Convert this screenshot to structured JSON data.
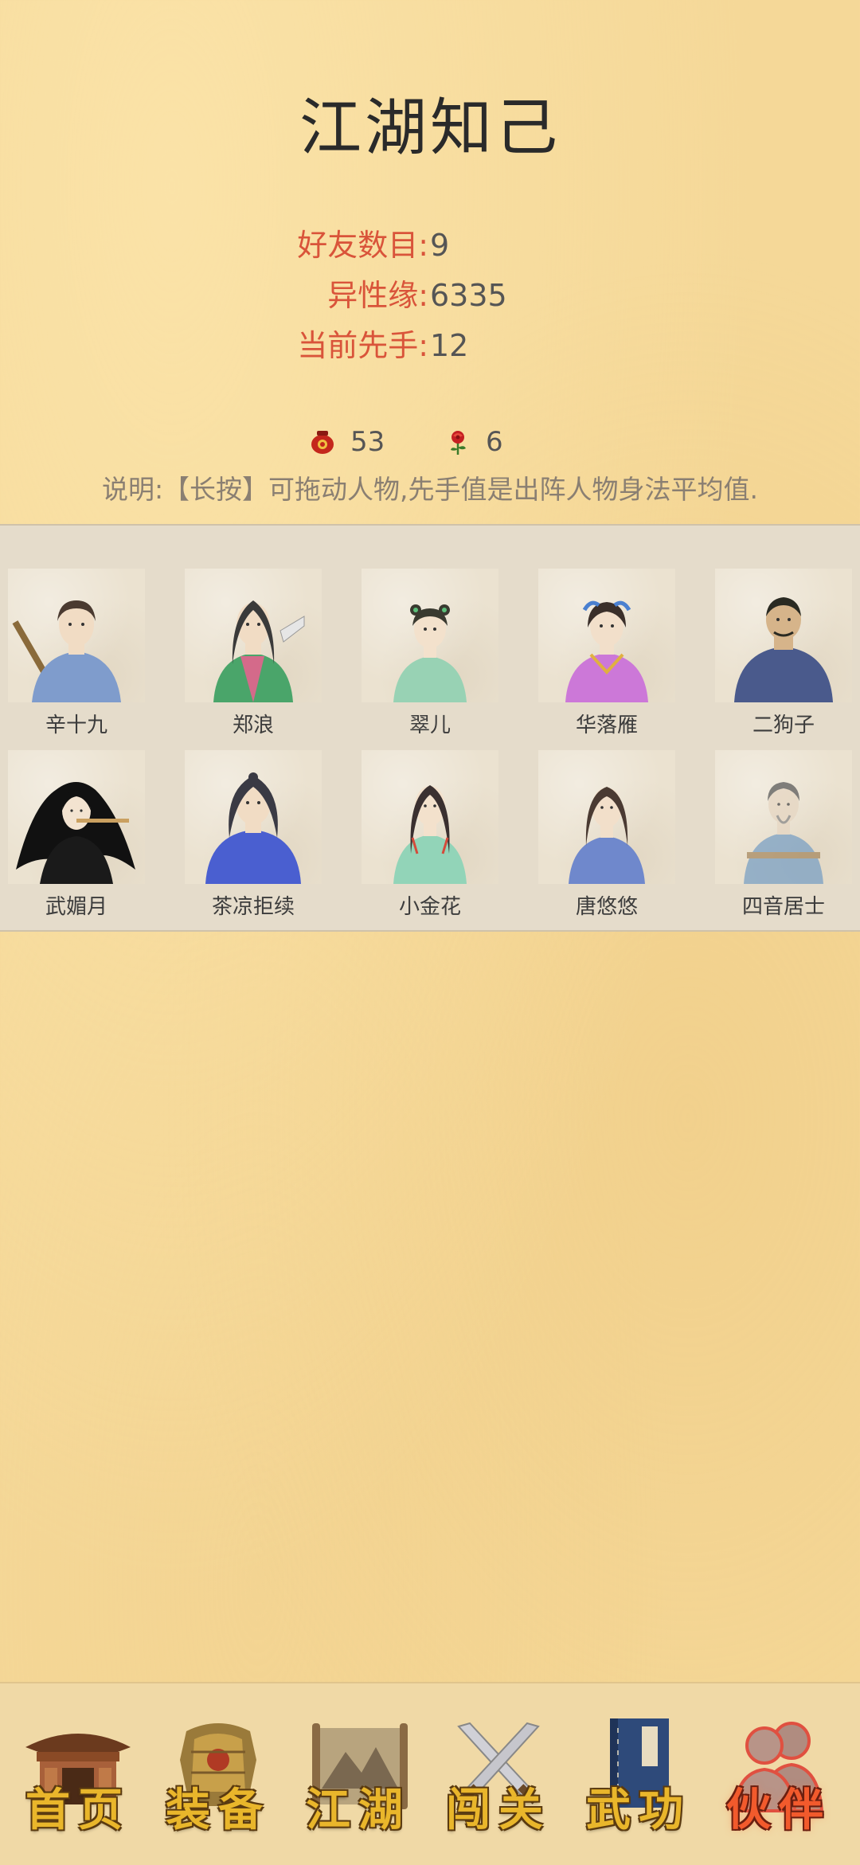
{
  "page": {
    "title": "江湖知己"
  },
  "stats": [
    {
      "label": "好友数目:",
      "value": "9"
    },
    {
      "label": "异性缘:",
      "value": "6335"
    },
    {
      "label": "当前先手:",
      "value": "12"
    }
  ],
  "resources": {
    "wine_count": "53",
    "rose_count": "6"
  },
  "note": "说明:【长按】可拖动人物,先手值是出阵人物身法平均值.",
  "characters": [
    {
      "name": "辛十九",
      "robe": "#7f9ccc",
      "hair": "#4a3a30"
    },
    {
      "name": "郑浪",
      "robe": "#4aa56a",
      "hair": "#3a3a3a"
    },
    {
      "name": "翠儿",
      "robe": "#98d2b4",
      "hair": "#3a3a30"
    },
    {
      "name": "华落雁",
      "robe": "#cc78d8",
      "hair": "#3a2f2a"
    },
    {
      "name": "二狗子",
      "robe": "#4a5a8c",
      "hair": "#2a2a22"
    },
    {
      "name": "武媚月",
      "robe": "#1a1a1a",
      "hair": "#111111"
    },
    {
      "name": "茶凉拒续",
      "robe": "#4a5fd0",
      "hair": "#3a3a44"
    },
    {
      "name": "小金花",
      "robe": "#92d4b8",
      "hair": "#3a3030"
    },
    {
      "name": "唐悠悠",
      "robe": "#6f88cc",
      "hair": "#4a3a32"
    },
    {
      "name": "四音居士",
      "robe": "#7aa0c4",
      "hair": "#5a5a5a"
    }
  ],
  "tabbar": {
    "tabs": [
      {
        "label": "首页",
        "icon": "house-icon",
        "active": false
      },
      {
        "label": "装备",
        "icon": "armor-icon",
        "active": false
      },
      {
        "label": "江湖",
        "icon": "scroll-map-icon",
        "active": false
      },
      {
        "label": "闯关",
        "icon": "crossed-swords-icon",
        "active": false
      },
      {
        "label": "武功",
        "icon": "book-icon",
        "active": false
      },
      {
        "label": "伙伴",
        "icon": "partners-icon",
        "active": true
      }
    ]
  }
}
